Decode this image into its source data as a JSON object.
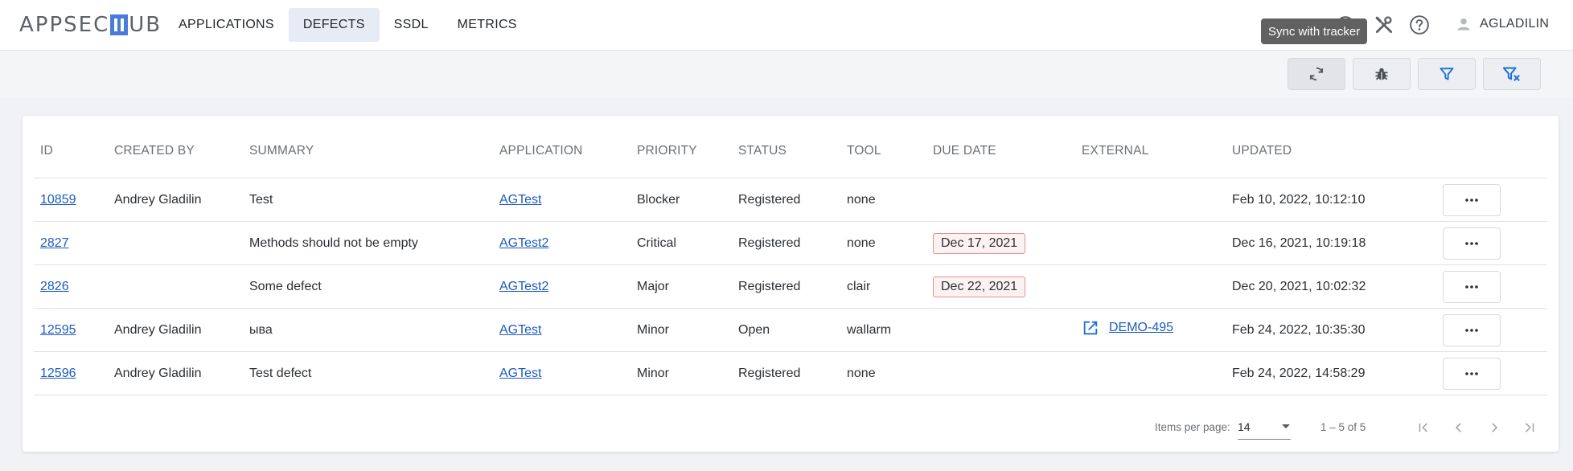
{
  "logo": {
    "left": "APPSEC",
    "right": "UB"
  },
  "nav": {
    "tabs": [
      {
        "label": "APPLICATIONS"
      },
      {
        "label": "DEFECTS"
      },
      {
        "label": "SSDL"
      },
      {
        "label": "METRICS"
      }
    ],
    "active_tab": "DEFECTS",
    "user": "AGLADILIN",
    "tooltip": "Sync with tracker"
  },
  "toolbar": {
    "buttons": [
      "sync-icon",
      "bug-icon",
      "filter-icon",
      "clear-filter-icon"
    ]
  },
  "table": {
    "columns": [
      "ID",
      "CREATED BY",
      "SUMMARY",
      "APPLICATION",
      "PRIORITY",
      "STATUS",
      "TOOL",
      "DUE DATE",
      "EXTERNAL",
      "UPDATED"
    ],
    "rows": [
      {
        "id": "10859",
        "created_by": "Andrey Gladilin",
        "summary": "Test",
        "application": "AGTest",
        "priority": "Blocker",
        "status": "Registered",
        "tool": "none",
        "due_date": "",
        "external": "",
        "updated": "Feb 10, 2022, 10:12:10"
      },
      {
        "id": "2827",
        "created_by": "",
        "summary": "Methods should not be empty",
        "application": "AGTest2",
        "priority": "Critical",
        "status": "Registered",
        "tool": "none",
        "due_date": "Dec 17, 2021",
        "external": "",
        "updated": "Dec 16, 2021, 10:19:18"
      },
      {
        "id": "2826",
        "created_by": "",
        "summary": "Some defect",
        "application": "AGTest2",
        "priority": "Major",
        "status": "Registered",
        "tool": "clair",
        "due_date": "Dec 22, 2021",
        "external": "",
        "updated": "Dec 20, 2021, 10:02:32"
      },
      {
        "id": "12595",
        "created_by": "Andrey Gladilin",
        "summary": "ыва",
        "application": "AGTest",
        "priority": "Minor",
        "status": "Open",
        "tool": "wallarm",
        "due_date": "",
        "external": "DEMO-495",
        "updated": "Feb 24, 2022, 10:35:30"
      },
      {
        "id": "12596",
        "created_by": "Andrey Gladilin",
        "summary": "Test defect",
        "application": "AGTest",
        "priority": "Minor",
        "status": "Registered",
        "tool": "none",
        "due_date": "",
        "external": "",
        "updated": "Feb 24, 2022, 14:58:29"
      }
    ]
  },
  "pager": {
    "items_per_page_label": "Items per page:",
    "items_per_page": "14",
    "range": "1 – 5 of 5"
  },
  "colors": {
    "accent": "#1d5bbf",
    "due_border": "#e58f8f",
    "active_tab_bg": "#e6ecf5"
  }
}
